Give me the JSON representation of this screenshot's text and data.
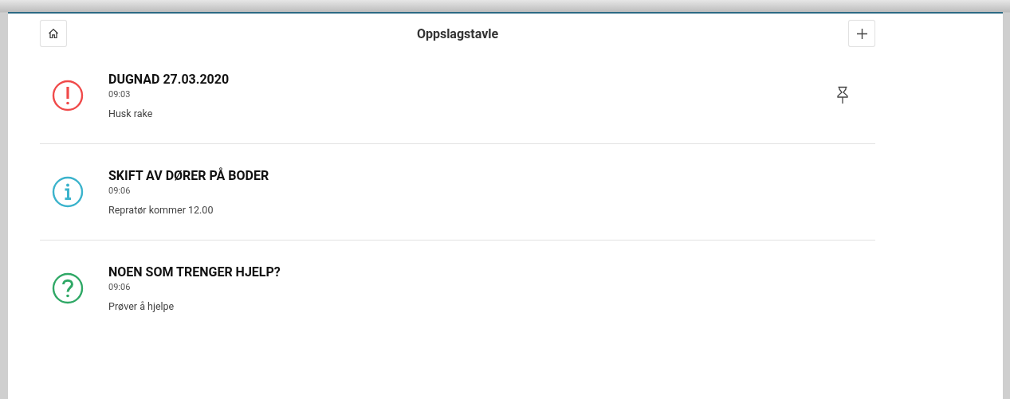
{
  "header": {
    "title": "Oppslagstavle"
  },
  "posts": [
    {
      "kind": "alert",
      "color": "#f04a4a",
      "title": "DUGNAD 27.03.2020",
      "time": "09:03",
      "body": "Husk rake",
      "pinned": true
    },
    {
      "kind": "info",
      "color": "#3bb3cc",
      "title": "SKIFT AV DØRER PÅ BODER",
      "time": "09:06",
      "body": "Repratør kommer 12.00",
      "pinned": false
    },
    {
      "kind": "question",
      "color": "#2fa866",
      "title": "NOEN SOM TRENGER HJELP?",
      "time": "09:06",
      "body": "Prøver å hjelpe",
      "pinned": false
    }
  ]
}
